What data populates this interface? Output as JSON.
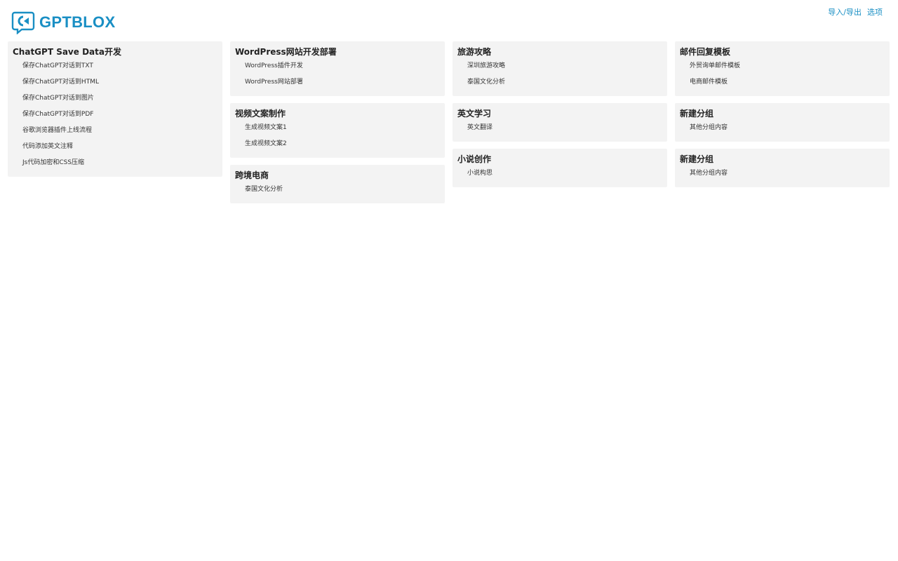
{
  "header": {
    "logo_text": "GPTBLOX",
    "import_export": "导入/导出",
    "options": "选项"
  },
  "columns": [
    {
      "groups": [
        {
          "title": "ChatGPT Save Data开发",
          "items": [
            "保存ChatGPT对话到TXT",
            "保存ChatGPT对话到HTML",
            "保存ChatGPT对话到图片",
            "保存ChatGPT对话到PDF",
            "谷歌浏览器插件上线流程",
            "代码添加英文注释",
            "Js代码加密和CSS压缩"
          ]
        }
      ]
    },
    {
      "groups": [
        {
          "title": "WordPress网站开发部署",
          "items": [
            "WordPress插件开发",
            "WordPress网站部署"
          ]
        },
        {
          "title": "视频文案制作",
          "items": [
            "生成视频文案1",
            "生成视频文案2"
          ]
        },
        {
          "title": "跨境电商",
          "items": [
            "泰国文化分析"
          ]
        }
      ]
    },
    {
      "groups": [
        {
          "title": "旅游攻略",
          "items": [
            "深圳旅游攻略",
            "泰国文化分析"
          ]
        },
        {
          "title": "英文学习",
          "items": [
            "英文翻译"
          ]
        },
        {
          "title": "小说创作",
          "items": [
            "小说构思"
          ]
        }
      ]
    },
    {
      "groups": [
        {
          "title": "邮件回复模板",
          "items": [
            "外贸询单邮件模板",
            "电商邮件模板"
          ]
        },
        {
          "title": "新建分组",
          "items": [
            "其他分组内容"
          ]
        },
        {
          "title": "新建分组",
          "items": [
            "其他分组内容"
          ]
        }
      ]
    }
  ],
  "colors": {
    "accent": "#1a8fc4",
    "group_bg": "#f3f3f3"
  }
}
